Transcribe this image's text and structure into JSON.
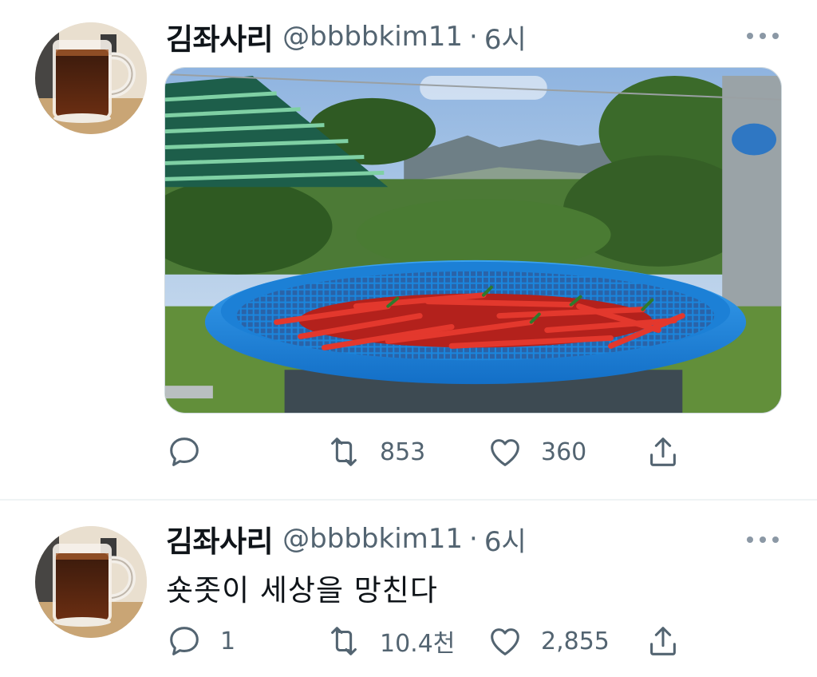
{
  "tweets": [
    {
      "author": {
        "name": "김좌사리",
        "handle": "@bbbbkim11"
      },
      "separator": "·",
      "time": "6시",
      "text": "",
      "media": {
        "description": "photo",
        "colors": {
          "sky": "#a9c8ea",
          "basket": "#1e8ee6",
          "peppers": "#c8201c",
          "grass": "#5c8a3a"
        }
      },
      "actions": {
        "reply_count": "",
        "retweet_count": "853",
        "like_count": "360"
      }
    },
    {
      "author": {
        "name": "김좌사리",
        "handle": "@bbbbkim11"
      },
      "separator": "·",
      "time": "6시",
      "text": "숏좃이 세상을 망친다",
      "actions": {
        "reply_count": "1",
        "retweet_count": "10.4천",
        "like_count": "2,855"
      }
    }
  ],
  "icons": {
    "reply": "reply-icon",
    "retweet": "retweet-icon",
    "like": "heart-icon",
    "share": "share-icon",
    "more": "more-icon"
  },
  "colors": {
    "text": "#0f1419",
    "muted": "#536471",
    "icon": "#536471",
    "divider": "#eff3f4"
  }
}
